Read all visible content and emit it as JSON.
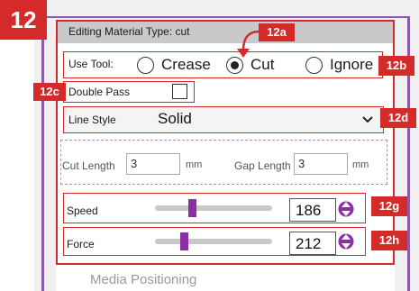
{
  "callouts": {
    "main": "12",
    "a": "12a",
    "b": "12b",
    "c": "12c",
    "d": "12d",
    "g": "12g",
    "h": "12h"
  },
  "header": {
    "title": "Editing Material Type: cut"
  },
  "use_tool": {
    "label": "Use Tool:",
    "options": [
      "Crease",
      "Cut",
      "Ignore"
    ],
    "selected": "Cut"
  },
  "double_pass": {
    "label": "Double Pass",
    "checked": false
  },
  "line_style": {
    "label": "Line Style",
    "value": "Solid"
  },
  "dash": {
    "cut_length_label": "Cut Length",
    "cut_length_value": "3",
    "gap_length_label": "Gap Length",
    "gap_length_value": "3",
    "unit": "mm"
  },
  "speed": {
    "label": "Speed",
    "value": "186",
    "slider_fraction": 0.33
  },
  "force": {
    "label": "Force",
    "value": "212",
    "slider_fraction": 0.24
  },
  "media_positioning": {
    "label": "Media Positioning"
  },
  "colors": {
    "callout_red": "#d42a2a",
    "accent_purple": "#8a2fa4"
  }
}
